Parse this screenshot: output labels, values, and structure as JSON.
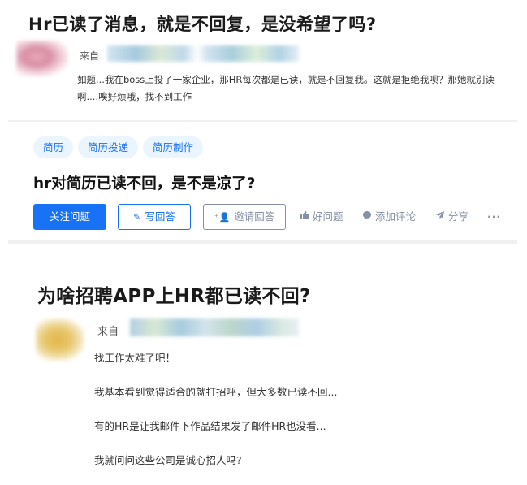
{
  "post1": {
    "title": "Hr已读了消息，就是不回复，是没希望了吗?",
    "from_label": "来自",
    "body": "如题...我在boss上投了一家企业，那HR每次都是已读，就是不回复我。这就是拒绝我呗？那她就别读啊....唉好烦哦，找不到工作"
  },
  "question": {
    "tags": [
      "简历",
      "简历投递",
      "简历制作"
    ],
    "title": "hr对简历已读不回，是不是凉了?",
    "follow_label": "关注问题",
    "answer_label": "写回答",
    "invite_label": "邀请回答",
    "good_question_label": "好问题",
    "add_comment_label": "添加评论",
    "share_label": "分享",
    "more_label": "···",
    "icons": {
      "answer": "pencil-icon",
      "invite": "add-user-icon",
      "good": "thumbs-up-icon",
      "comment": "comment-bubble-icon",
      "share": "paper-plane-icon",
      "more": "more-dots-icon"
    },
    "colors": {
      "accent": "#1772f6",
      "muted": "#8590a6",
      "tag_bg": "#ebf5ff"
    }
  },
  "post2": {
    "title": "为啥招聘APP上HR都已读不回?",
    "from_label": "来自",
    "lines": [
      "找工作太难了吧！",
      "我基本看到觉得适合的就打招呼，但大多数已读不回...",
      "有的HR是让我邮件下作品结果发了邮件HR也没看...",
      "我就问问这些公司是诚心招人吗?"
    ]
  }
}
